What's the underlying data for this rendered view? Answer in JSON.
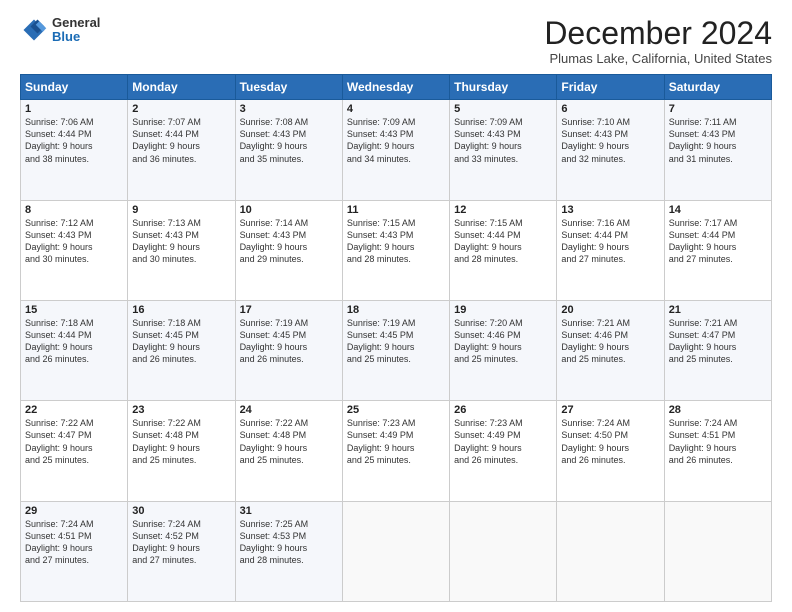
{
  "logo": {
    "general": "General",
    "blue": "Blue"
  },
  "header": {
    "month": "December 2024",
    "location": "Plumas Lake, California, United States"
  },
  "weekdays": [
    "Sunday",
    "Monday",
    "Tuesday",
    "Wednesday",
    "Thursday",
    "Friday",
    "Saturday"
  ],
  "weeks": [
    [
      {
        "day": "1",
        "lines": [
          "Sunrise: 7:06 AM",
          "Sunset: 4:44 PM",
          "Daylight: 9 hours",
          "and 38 minutes."
        ]
      },
      {
        "day": "2",
        "lines": [
          "Sunrise: 7:07 AM",
          "Sunset: 4:44 PM",
          "Daylight: 9 hours",
          "and 36 minutes."
        ]
      },
      {
        "day": "3",
        "lines": [
          "Sunrise: 7:08 AM",
          "Sunset: 4:43 PM",
          "Daylight: 9 hours",
          "and 35 minutes."
        ]
      },
      {
        "day": "4",
        "lines": [
          "Sunrise: 7:09 AM",
          "Sunset: 4:43 PM",
          "Daylight: 9 hours",
          "and 34 minutes."
        ]
      },
      {
        "day": "5",
        "lines": [
          "Sunrise: 7:09 AM",
          "Sunset: 4:43 PM",
          "Daylight: 9 hours",
          "and 33 minutes."
        ]
      },
      {
        "day": "6",
        "lines": [
          "Sunrise: 7:10 AM",
          "Sunset: 4:43 PM",
          "Daylight: 9 hours",
          "and 32 minutes."
        ]
      },
      {
        "day": "7",
        "lines": [
          "Sunrise: 7:11 AM",
          "Sunset: 4:43 PM",
          "Daylight: 9 hours",
          "and 31 minutes."
        ]
      }
    ],
    [
      {
        "day": "8",
        "lines": [
          "Sunrise: 7:12 AM",
          "Sunset: 4:43 PM",
          "Daylight: 9 hours",
          "and 30 minutes."
        ]
      },
      {
        "day": "9",
        "lines": [
          "Sunrise: 7:13 AM",
          "Sunset: 4:43 PM",
          "Daylight: 9 hours",
          "and 30 minutes."
        ]
      },
      {
        "day": "10",
        "lines": [
          "Sunrise: 7:14 AM",
          "Sunset: 4:43 PM",
          "Daylight: 9 hours",
          "and 29 minutes."
        ]
      },
      {
        "day": "11",
        "lines": [
          "Sunrise: 7:15 AM",
          "Sunset: 4:43 PM",
          "Daylight: 9 hours",
          "and 28 minutes."
        ]
      },
      {
        "day": "12",
        "lines": [
          "Sunrise: 7:15 AM",
          "Sunset: 4:44 PM",
          "Daylight: 9 hours",
          "and 28 minutes."
        ]
      },
      {
        "day": "13",
        "lines": [
          "Sunrise: 7:16 AM",
          "Sunset: 4:44 PM",
          "Daylight: 9 hours",
          "and 27 minutes."
        ]
      },
      {
        "day": "14",
        "lines": [
          "Sunrise: 7:17 AM",
          "Sunset: 4:44 PM",
          "Daylight: 9 hours",
          "and 27 minutes."
        ]
      }
    ],
    [
      {
        "day": "15",
        "lines": [
          "Sunrise: 7:18 AM",
          "Sunset: 4:44 PM",
          "Daylight: 9 hours",
          "and 26 minutes."
        ]
      },
      {
        "day": "16",
        "lines": [
          "Sunrise: 7:18 AM",
          "Sunset: 4:45 PM",
          "Daylight: 9 hours",
          "and 26 minutes."
        ]
      },
      {
        "day": "17",
        "lines": [
          "Sunrise: 7:19 AM",
          "Sunset: 4:45 PM",
          "Daylight: 9 hours",
          "and 26 minutes."
        ]
      },
      {
        "day": "18",
        "lines": [
          "Sunrise: 7:19 AM",
          "Sunset: 4:45 PM",
          "Daylight: 9 hours",
          "and 25 minutes."
        ]
      },
      {
        "day": "19",
        "lines": [
          "Sunrise: 7:20 AM",
          "Sunset: 4:46 PM",
          "Daylight: 9 hours",
          "and 25 minutes."
        ]
      },
      {
        "day": "20",
        "lines": [
          "Sunrise: 7:21 AM",
          "Sunset: 4:46 PM",
          "Daylight: 9 hours",
          "and 25 minutes."
        ]
      },
      {
        "day": "21",
        "lines": [
          "Sunrise: 7:21 AM",
          "Sunset: 4:47 PM",
          "Daylight: 9 hours",
          "and 25 minutes."
        ]
      }
    ],
    [
      {
        "day": "22",
        "lines": [
          "Sunrise: 7:22 AM",
          "Sunset: 4:47 PM",
          "Daylight: 9 hours",
          "and 25 minutes."
        ]
      },
      {
        "day": "23",
        "lines": [
          "Sunrise: 7:22 AM",
          "Sunset: 4:48 PM",
          "Daylight: 9 hours",
          "and 25 minutes."
        ]
      },
      {
        "day": "24",
        "lines": [
          "Sunrise: 7:22 AM",
          "Sunset: 4:48 PM",
          "Daylight: 9 hours",
          "and 25 minutes."
        ]
      },
      {
        "day": "25",
        "lines": [
          "Sunrise: 7:23 AM",
          "Sunset: 4:49 PM",
          "Daylight: 9 hours",
          "and 25 minutes."
        ]
      },
      {
        "day": "26",
        "lines": [
          "Sunrise: 7:23 AM",
          "Sunset: 4:49 PM",
          "Daylight: 9 hours",
          "and 26 minutes."
        ]
      },
      {
        "day": "27",
        "lines": [
          "Sunrise: 7:24 AM",
          "Sunset: 4:50 PM",
          "Daylight: 9 hours",
          "and 26 minutes."
        ]
      },
      {
        "day": "28",
        "lines": [
          "Sunrise: 7:24 AM",
          "Sunset: 4:51 PM",
          "Daylight: 9 hours",
          "and 26 minutes."
        ]
      }
    ],
    [
      {
        "day": "29",
        "lines": [
          "Sunrise: 7:24 AM",
          "Sunset: 4:51 PM",
          "Daylight: 9 hours",
          "and 27 minutes."
        ]
      },
      {
        "day": "30",
        "lines": [
          "Sunrise: 7:24 AM",
          "Sunset: 4:52 PM",
          "Daylight: 9 hours",
          "and 27 minutes."
        ]
      },
      {
        "day": "31",
        "lines": [
          "Sunrise: 7:25 AM",
          "Sunset: 4:53 PM",
          "Daylight: 9 hours",
          "and 28 minutes."
        ]
      },
      null,
      null,
      null,
      null
    ]
  ]
}
